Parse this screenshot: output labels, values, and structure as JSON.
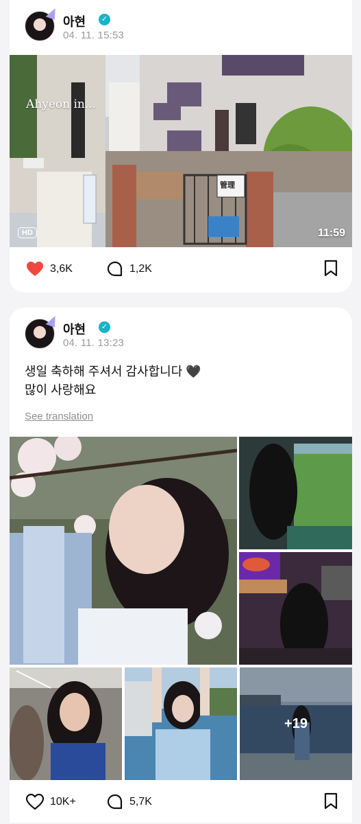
{
  "posts": [
    {
      "author": {
        "name": "아현",
        "date": "04. 11. 15:53"
      },
      "media": {
        "overlay_text": "Ahyeon in...",
        "quality_badge": "HD",
        "duration": "11:59",
        "sign_text": "管理"
      },
      "stats": {
        "likes": "3,6K",
        "comments": "1,2K",
        "liked": true
      }
    },
    {
      "author": {
        "name": "아현",
        "date": "04. 11. 13:23"
      },
      "text_line1": "생일 축하해 주셔서 감사합니다 🖤",
      "text_line2": "많이 사랑해요",
      "see_translation": "See translation",
      "more_photos": "+19",
      "stats": {
        "likes": "10K+",
        "comments": "5,7K",
        "liked": false
      }
    }
  ],
  "icons": {
    "verified": "verified-badge-icon",
    "like": "heart-icon",
    "comment": "comment-bubble-icon",
    "bookmark": "bookmark-icon"
  },
  "colors": {
    "verified": "#18b3c8",
    "liked_heart": "#f0483e",
    "meta_text": "#9a9a9a"
  }
}
